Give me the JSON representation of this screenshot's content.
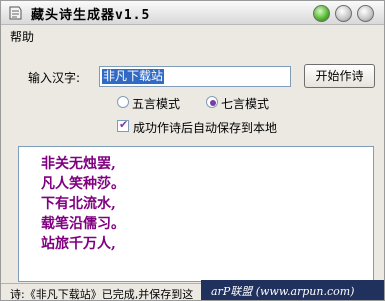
{
  "window": {
    "title": "藏头诗生成器v1.5"
  },
  "menu": {
    "help": "帮助"
  },
  "form": {
    "input_label": "输入汉字:",
    "input_value": "非凡下载站",
    "start_button": "开始作诗",
    "radio_five": "五言模式",
    "radio_seven": "七言模式",
    "selected_mode": "七言模式",
    "autosave_label": "成功作诗后自动保存到本地",
    "autosave_checked": true
  },
  "output": {
    "lines": [
      "非关无烛罢,",
      "凡人笑种莎。",
      "下有北流水,",
      "载笔沿儒习。",
      "站旅千万人,"
    ]
  },
  "status": {
    "text": "诗:《非凡下载站》已完成,并保存到这"
  },
  "watermark": {
    "text": "arP联盟 (www.arpun.com)"
  },
  "colors": {
    "poem": "#800080",
    "selection": "#316ac5"
  },
  "icons": {
    "app": "app-icon",
    "minimize": "minimize-icon",
    "maximize": "maximize-icon",
    "close": "close-icon"
  }
}
